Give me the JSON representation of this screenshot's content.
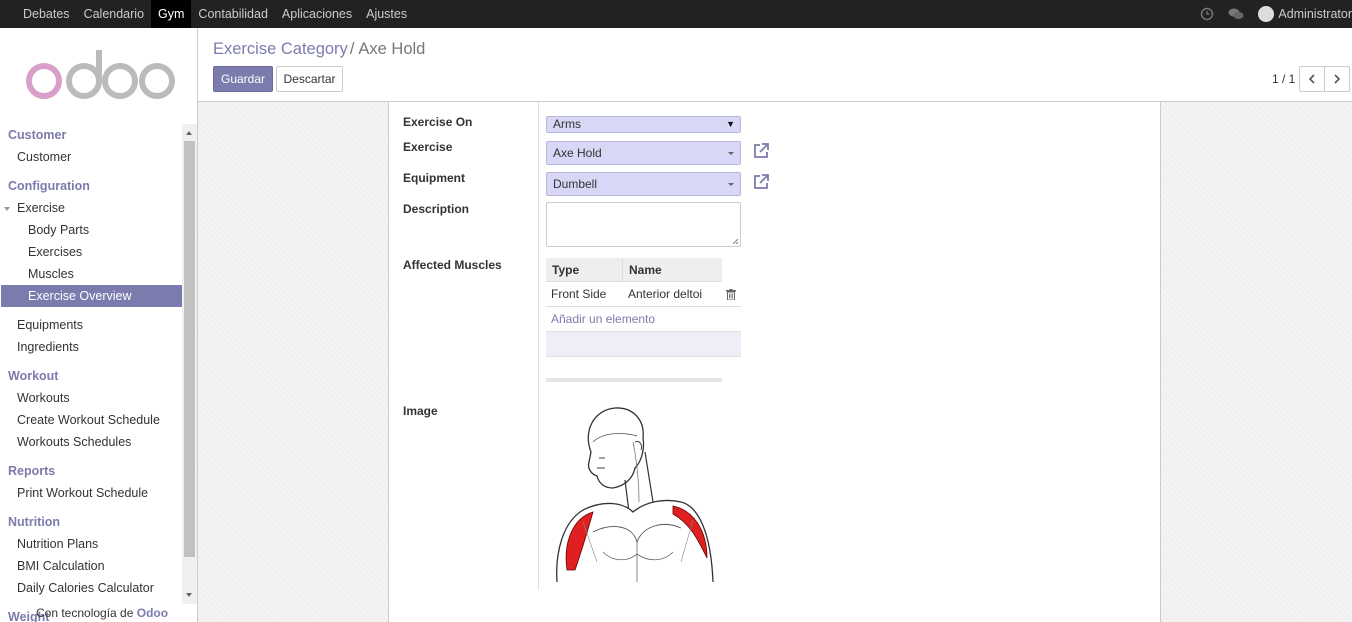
{
  "topbar": {
    "menu": [
      "Debates",
      "Calendario",
      "Gym",
      "Contabilidad",
      "Aplicaciones",
      "Ajustes"
    ],
    "active": "Gym",
    "user": "Administrator"
  },
  "sidebar": {
    "sections": {
      "customer": {
        "title": "Customer",
        "items": [
          "Customer"
        ]
      },
      "configuration": {
        "title": "Configuration",
        "exercise": "Exercise",
        "sub_items": [
          "Body Parts",
          "Exercises",
          "Muscles",
          "Exercise Overview"
        ],
        "items": [
          "Equipments",
          "Ingredients"
        ]
      },
      "workout": {
        "title": "Workout",
        "items": [
          "Workouts",
          "Create Workout Schedule",
          "Workouts Schedules"
        ]
      },
      "reports": {
        "title": "Reports",
        "items": [
          "Print Workout Schedule"
        ]
      },
      "nutrition": {
        "title": "Nutrition",
        "items": [
          "Nutrition Plans",
          "BMI Calculation",
          "Daily Calories Calculator"
        ]
      },
      "weight": {
        "title": "Weight"
      }
    },
    "active_item": "Exercise Overview",
    "powered_prefix": "Con tecnología de",
    "powered_brand": "Odoo"
  },
  "control_panel": {
    "breadcrumb_parent": "Exercise Category",
    "breadcrumb_sep": "/",
    "breadcrumb_current": "Axe Hold",
    "save_label": "Guardar",
    "discard_label": "Descartar",
    "pager": "1 / 1"
  },
  "form": {
    "exercise_on_label": "Exercise On",
    "exercise_on_value": "Arms",
    "exercise_label": "Exercise",
    "exercise_value": "Axe Hold",
    "equipment_label": "Equipment",
    "equipment_value": "Dumbell",
    "description_label": "Description",
    "description_value": "",
    "affected_muscles_label": "Affected Muscles",
    "muscles_table": {
      "headers": [
        "Type",
        "Name"
      ],
      "rows": [
        [
          "Front Side",
          "Anterior deltoi"
        ]
      ],
      "add_label": "Añadir un elemento"
    },
    "image_label": "Image"
  },
  "colors": {
    "accent": "#7c7bad",
    "topbar": "#222222",
    "select_bg": "#d8d7f5",
    "muscle_highlight": "#e02020"
  }
}
